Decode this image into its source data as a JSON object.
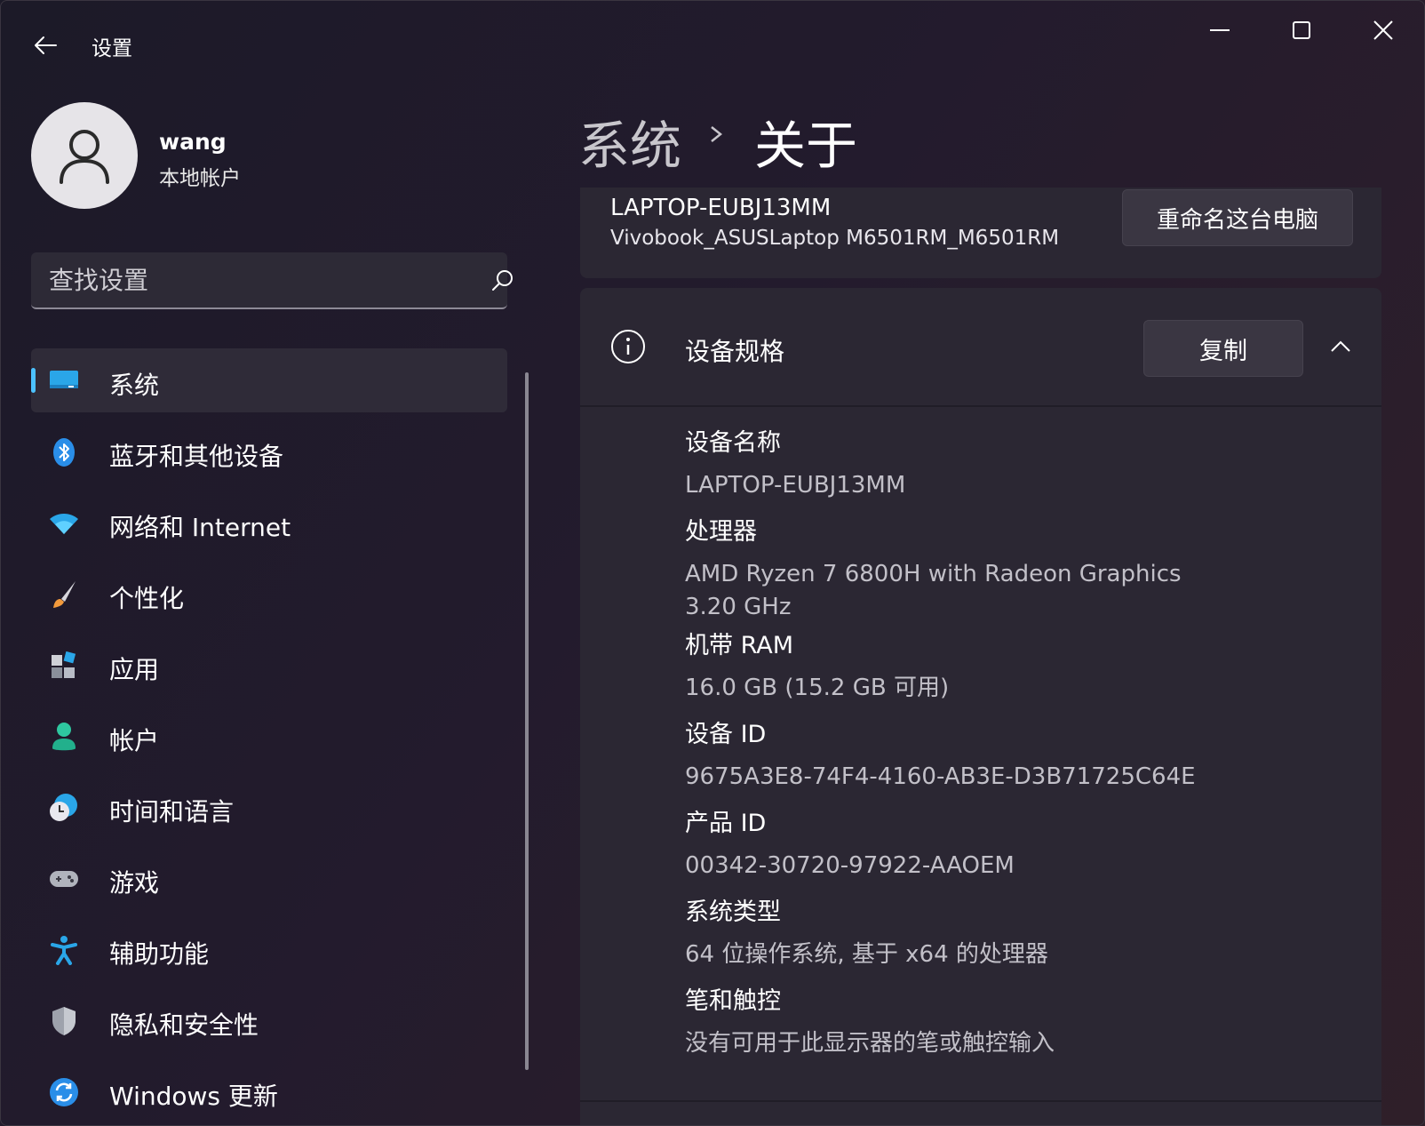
{
  "window": {
    "title": "设置"
  },
  "profile": {
    "name": "wang",
    "account_type": "本地帐户"
  },
  "search": {
    "placeholder": "查找设置"
  },
  "sidebar": {
    "items": [
      {
        "label": "系统",
        "icon": "monitor-icon",
        "active": true
      },
      {
        "label": "蓝牙和其他设备",
        "icon": "bluetooth-icon"
      },
      {
        "label": "网络和 Internet",
        "icon": "wifi-icon"
      },
      {
        "label": "个性化",
        "icon": "brush-icon"
      },
      {
        "label": "应用",
        "icon": "apps-icon"
      },
      {
        "label": "帐户",
        "icon": "person-icon"
      },
      {
        "label": "时间和语言",
        "icon": "globe-clock-icon"
      },
      {
        "label": "游戏",
        "icon": "gamepad-icon"
      },
      {
        "label": "辅助功能",
        "icon": "accessibility-icon"
      },
      {
        "label": "隐私和安全性",
        "icon": "shield-icon"
      },
      {
        "label": "Windows 更新",
        "icon": "update-icon"
      }
    ]
  },
  "header": {
    "parent": "系统",
    "current": "关于"
  },
  "device_card": {
    "pc_name": "LAPTOP-EUBJ13MM",
    "model": "Vivobook_ASUSLaptop M6501RM_M6501RM",
    "rename_label": "重命名这台电脑"
  },
  "specs": {
    "title": "设备规格",
    "copy_label": "复制",
    "rows": [
      {
        "label": "设备名称",
        "value": "LAPTOP-EUBJ13MM"
      },
      {
        "label": "处理器",
        "value": "AMD Ryzen 7 6800H with Radeon Graphics              3.20 GHz"
      },
      {
        "label": "机带 RAM",
        "value": "16.0 GB (15.2 GB 可用)"
      },
      {
        "label": "设备 ID",
        "value": "9675A3E8-74F4-4160-AB3E-D3B71725C64E"
      },
      {
        "label": "产品 ID",
        "value": "00342-30720-97922-AAOEM"
      },
      {
        "label": "系统类型",
        "value": "64 位操作系统, 基于 x64 的处理器"
      },
      {
        "label": "笔和触控",
        "value": "没有可用于此显示器的笔或触控输入"
      }
    ]
  },
  "colors": {
    "accent": "#4cc2ff",
    "background": "#231b2d",
    "card": "#2b2733"
  }
}
